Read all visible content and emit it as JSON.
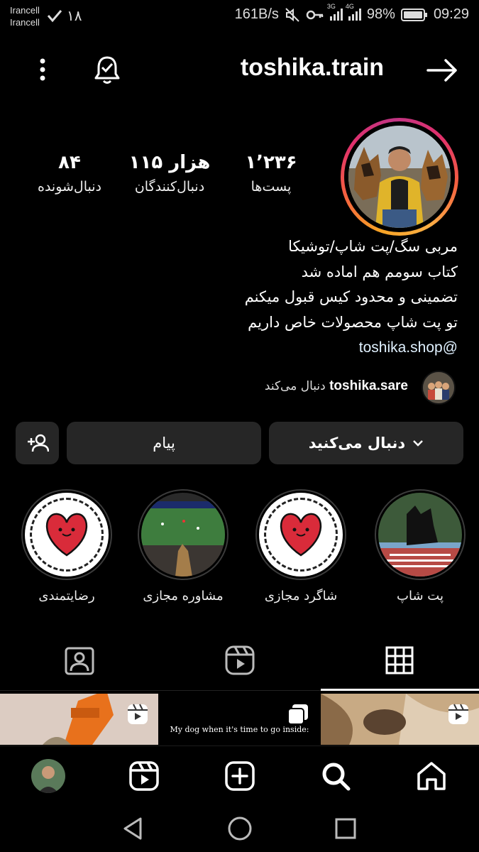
{
  "status_bar": {
    "carrier1": "Irancell",
    "carrier2": "Irancell",
    "notif_count": "۱۸",
    "net_speed": "161B/s",
    "sim1_gen": "3G",
    "sim2_gen": "4G",
    "battery": "98%",
    "time": "09:29"
  },
  "header": {
    "username": "toshika.train"
  },
  "stats": {
    "posts_value": "۱٬۲۳۶",
    "posts_label": "پست‌ها",
    "followers_value": "۱۱۵ هزار",
    "followers_label": "دنبال‌کنندگان",
    "following_value": "۸۴",
    "following_label": "دنبال‌شونده"
  },
  "bio": {
    "line1": "مربی سگ/پت شاپ/توشیکا",
    "line2": "کتاب سومم هم اماده شد",
    "line3": "تضمینی و محدود کیس قبول میکنم",
    "line4": "تو پت شاپ محصولات خاص داریم",
    "link": "toshika.shop@"
  },
  "followed_by": {
    "username": "toshika.sare",
    "suffix": "دنبال می‌کند"
  },
  "actions": {
    "following_label": "دنبال می‌کنید",
    "message_label": "پیام"
  },
  "highlights": [
    {
      "label": "پت شاپ"
    },
    {
      "label": "شاگرد مجازی"
    },
    {
      "label": "مشاوره مجازی"
    },
    {
      "label": "رضایتمندی"
    }
  ],
  "grid": {
    "post2_caption": "My dog when it's time to go inside:"
  },
  "colors": {
    "background": "#000000",
    "button_bg": "#262626",
    "heart_red": "#d92b3a",
    "story_ring_start": "#f7a325",
    "story_ring_end": "#c13584"
  }
}
